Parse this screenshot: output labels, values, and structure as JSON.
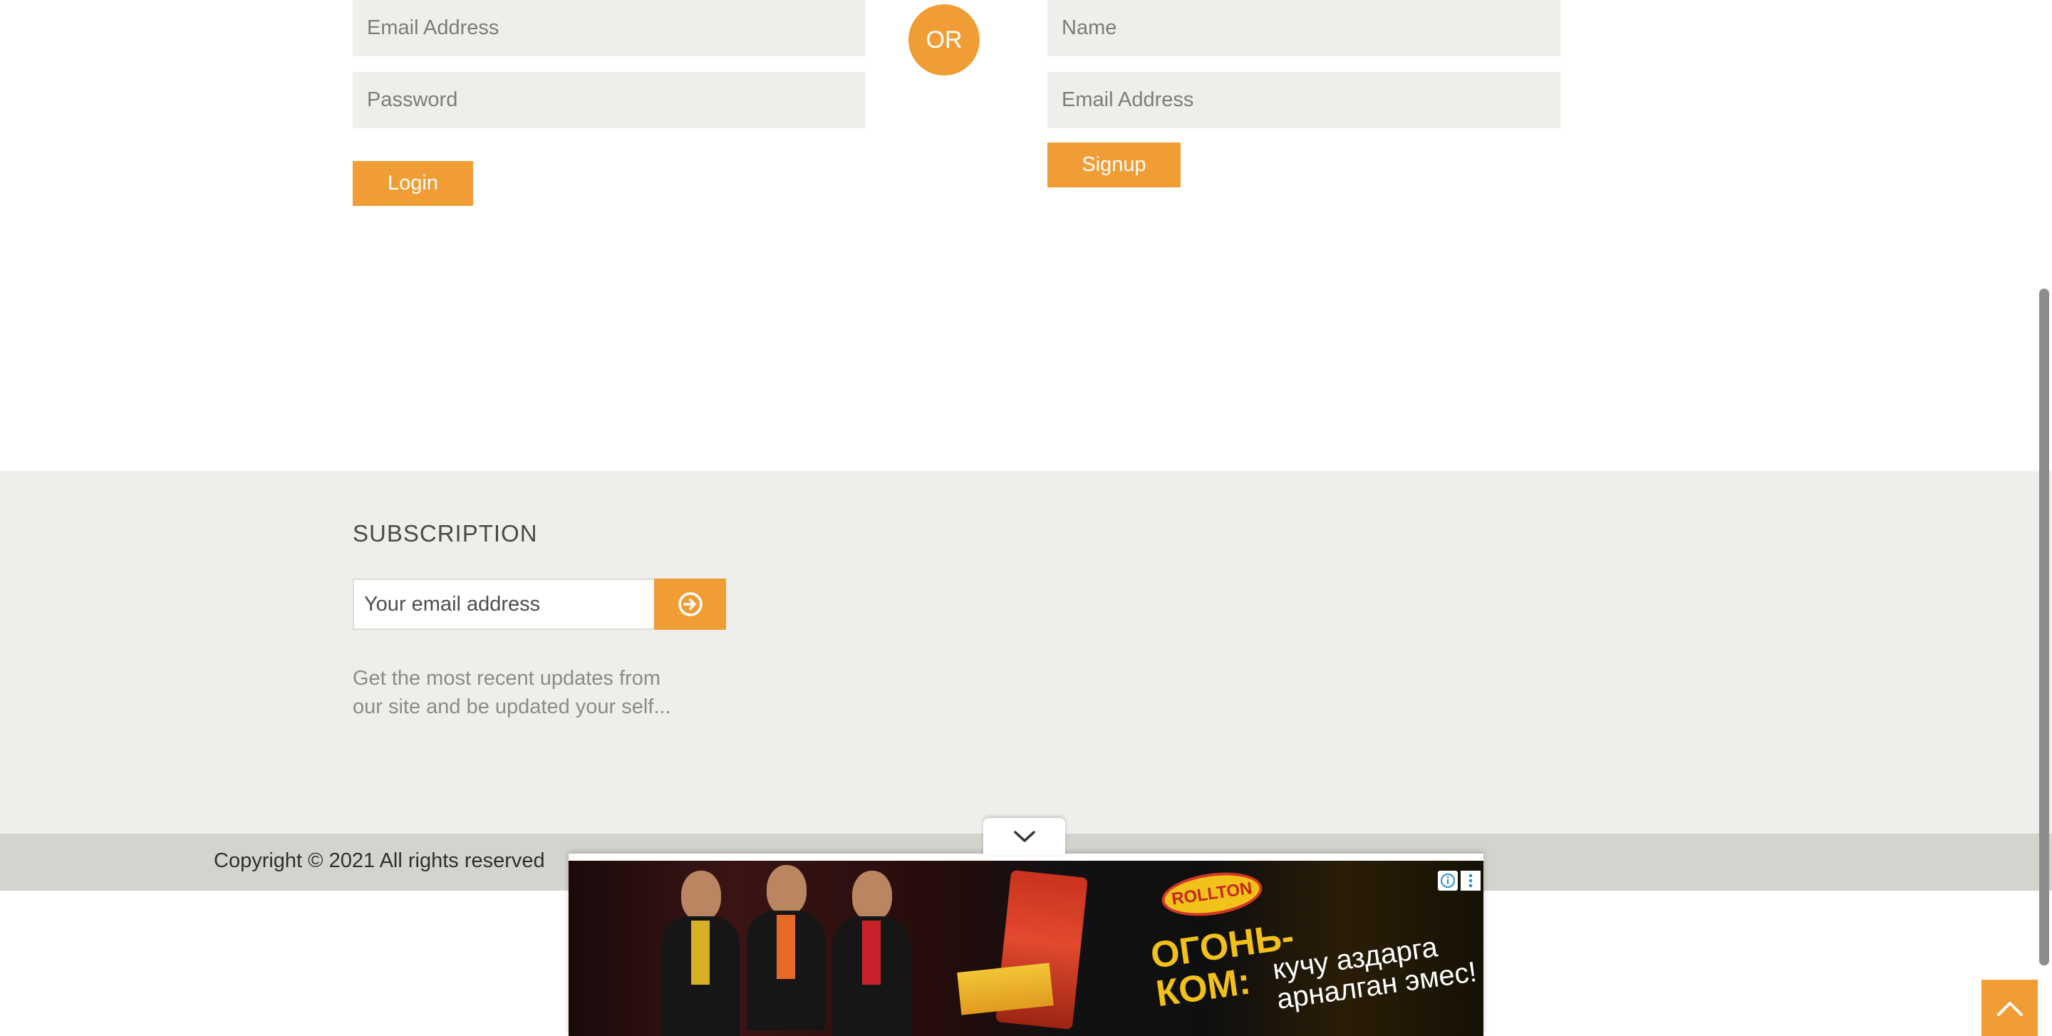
{
  "login": {
    "email_placeholder": "Email Address",
    "password_placeholder": "Password",
    "button_label": "Login"
  },
  "divider": {
    "label": "OR"
  },
  "signup": {
    "name_placeholder": "Name",
    "email_placeholder": "Email Address",
    "button_label": "Signup"
  },
  "subscription": {
    "heading": "SUBSCRIPTION",
    "email_placeholder": "Your email address",
    "submit_icon": "arrow-right-circle-icon",
    "description_line1": "Get the most recent updates from",
    "description_line2": "our site and be updated your self..."
  },
  "footer": {
    "copyright": "Copyright © 2021 All rights reserved"
  },
  "ad": {
    "brand": "ROLLTON",
    "slogan_big": "ОГОНЬ-КОМ:",
    "slogan_small": "кучу аздарга арналган эмес!",
    "collapse_icon": "chevron-down-icon",
    "info_icon": "info-icon",
    "menu_icon": "kebab-menu-icon"
  },
  "back_to_top": {
    "icon": "chevron-up-icon"
  },
  "colors": {
    "accent": "#f19d36",
    "field_bg": "#eeeeea",
    "footer_bg": "#d4d4cf"
  }
}
